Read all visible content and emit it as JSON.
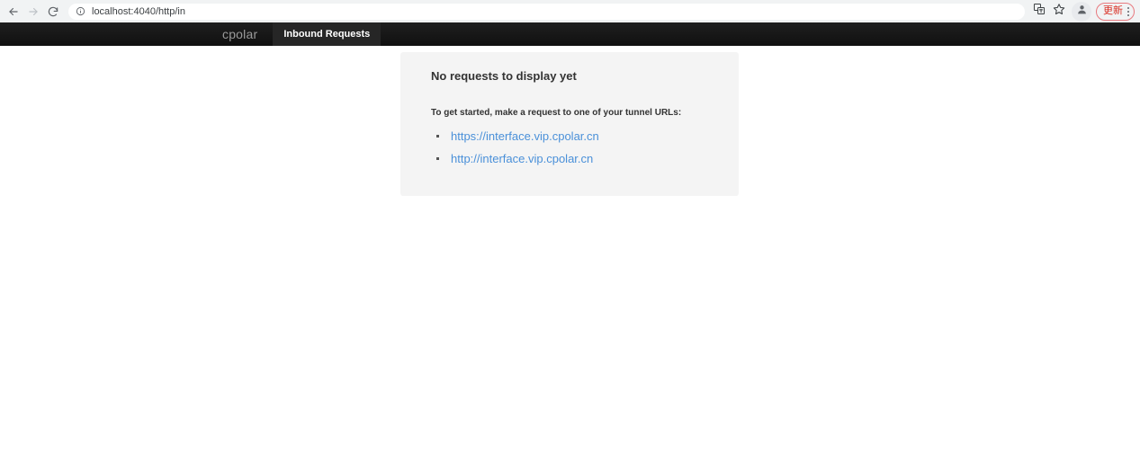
{
  "browser": {
    "back_icon": "back-arrow-icon",
    "forward_icon": "forward-arrow-icon",
    "reload_icon": "reload-icon",
    "site_info_icon": "info-circle-icon",
    "url": "localhost:4040/http/in",
    "url_placeholder": "Search Google or type a URL",
    "translate_icon": "translate-icon",
    "bookmark_icon": "star-icon",
    "profile_icon": "profile-avatar-icon",
    "update_label": "更新",
    "menu_icon": "three-dot-menu-icon",
    "accent_update_color": "#d93025"
  },
  "app": {
    "brand": "cpolar",
    "tabs": [
      {
        "label": "Inbound Requests",
        "active": true
      }
    ],
    "nav_background": "#161616"
  },
  "main": {
    "card": {
      "title": "No requests to display yet",
      "subtitle": "To get started, make a request to one of your tunnel URLs:",
      "links": [
        {
          "label": "https://interface.vip.cpolar.cn"
        },
        {
          "label": "http://interface.vip.cpolar.cn"
        }
      ],
      "background": "#f4f4f4",
      "link_color": "#4a90d9"
    }
  }
}
